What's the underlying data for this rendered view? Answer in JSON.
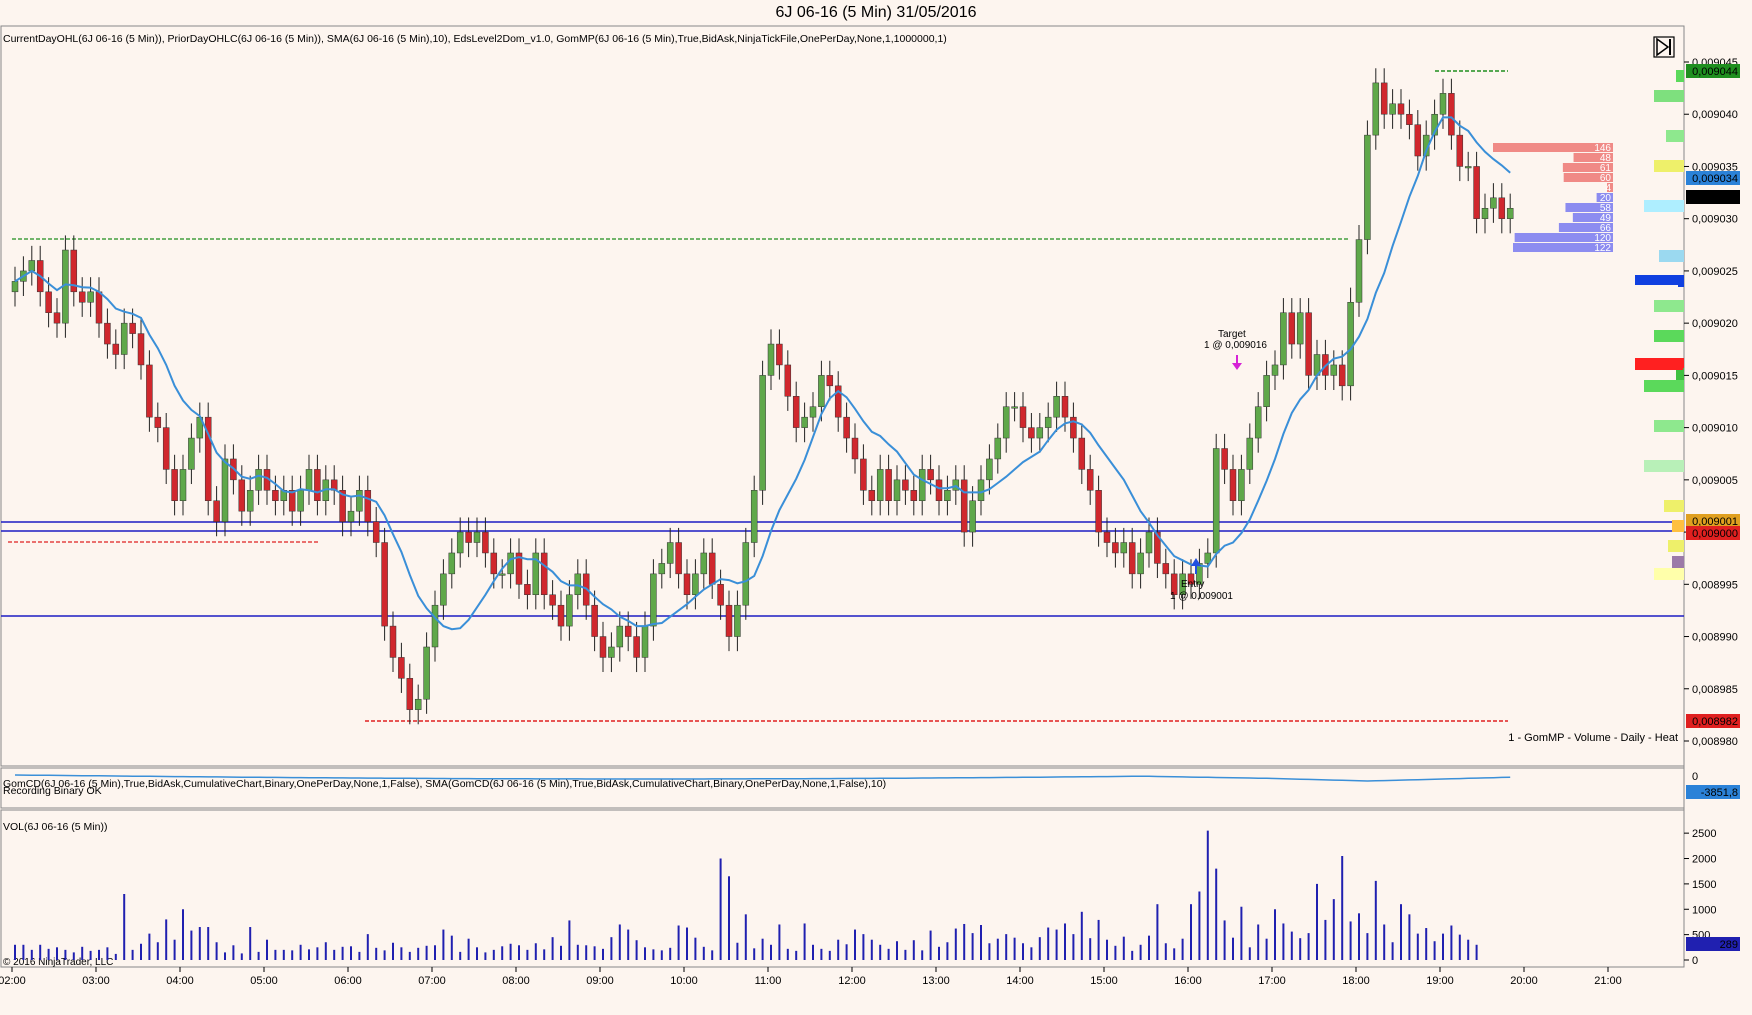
{
  "window": {
    "title": "6J 06-16 (5 Min)  31/05/2016"
  },
  "indicators": {
    "main": "CurrentDayOHL(6J 06-16 (5 Min)), PriorDayOHLC(6J 06-16 (5 Min)), SMA(6J 06-16 (5 Min),10), EdsLevel2Dom_v1.0, GomMP(6J 06-16 (5 Min),True,BidAsk,NinjaTickFile,OnePerDay,None,1,1000000,1)",
    "gomcd": "GomCD(6J 06-16 (5 Min),True,BidAsk,CumulativeChart,Binary,OnePerDay,None,1,False), SMA(GomCD(6J 06-16 (5 Min),True,BidAsk,CumulativeChart,Binary,OnePerDay,None,1,False),10)",
    "recording": "Recording Binary OK",
    "vol": "VOL(6J 06-16 (5 Min))",
    "profile": "1 - GomMP - Volume - Daily - Heat"
  },
  "footer": {
    "copyright": "© 2016 NinjaTrader, LLC"
  },
  "annotations": {
    "target_label": "Target",
    "target_price": "1 @ 0,009016",
    "entry_label": "Entry",
    "entry_price": "1 @ 0,009001"
  },
  "colors": {
    "background": "#fdf5ef",
    "bull": "#5fa84a",
    "bear": "#d0272d",
    "sma": "#3a8fd8",
    "hline": "#1c1cc4",
    "current_high": "#1f8f1f",
    "prior_low": "#e02020",
    "volume": "#2020b0"
  },
  "price_badges": {
    "high": "0,009044",
    "sma": "0,009034",
    "last": "0,009032",
    "level1": "0,009001",
    "level2": "0,009000",
    "low": "0,008982",
    "cd": "-3851,8",
    "vol": "289"
  },
  "dom": {
    "asks": [
      "146",
      "48",
      "61",
      "60",
      "4"
    ],
    "bids": [
      "20",
      "58",
      "49",
      "66",
      "120",
      "122"
    ]
  },
  "chart_data": {
    "type": "candlestick",
    "title": "6J 06-16 (5 Min)  31/05/2016",
    "x_ticks": [
      "02:00",
      "03:00",
      "04:00",
      "05:00",
      "06:00",
      "07:00",
      "08:00",
      "09:00",
      "10:00",
      "11:00",
      "12:00",
      "13:00",
      "14:00",
      "15:00",
      "16:00",
      "17:00",
      "18:00",
      "19:00",
      "20:00",
      "21:00"
    ],
    "y_ticks": [
      "0,008980",
      "0,008985",
      "0,008990",
      "0,008995",
      "0,009000",
      "0,009005",
      "0,009010",
      "0,009015",
      "0,009020",
      "0,009025",
      "0,009030",
      "0,009035",
      "0,009040",
      "0,009045"
    ],
    "ylim": [
      0.008978,
      0.009046
    ],
    "close": [
      9024,
      9025,
      9026,
      9023,
      9021,
      9020,
      9027,
      9023,
      9022,
      9023,
      9020,
      9018,
      9017,
      9020,
      9019,
      9016,
      9011,
      9010,
      9006,
      9003,
      9006,
      9009,
      9011,
      9003,
      9001,
      9007,
      9005,
      9002,
      9004,
      9006,
      9004,
      9003,
      9004,
      9002,
      9004,
      9006,
      9003,
      9005,
      9004,
      9001,
      9002,
      9004,
      9001,
      8999,
      8991,
      8988,
      8986,
      8983,
      8984,
      8989,
      8993,
      8996,
      8998,
      9000,
      8999,
      9000,
      8998,
      8996,
      8996,
      8998,
      8995,
      8994,
      8998,
      8994,
      8993,
      8991,
      8994,
      8996,
      8993,
      8990,
      8988,
      8989,
      8991,
      8990,
      8988,
      8991,
      8996,
      8997,
      8999,
      8996,
      8994,
      8996,
      8998,
      8995,
      8993,
      8990,
      8993,
      8999,
      9004,
      9015,
      9018,
      9016,
      9013,
      9010,
      9011,
      9012,
      9015,
      9014,
      9011,
      9009,
      9007,
      9004,
      9003,
      9006,
      9003,
      9005,
      9004,
      9003,
      9006,
      9005,
      9003,
      9004,
      9005,
      9000,
      9003,
      9005,
      9007,
      9009,
      9012,
      9012,
      9010,
      9009,
      9010,
      9011,
      9013,
      9011,
      9009,
      9006,
      9004,
      9000,
      8999,
      8998,
      8999,
      8996,
      8998,
      9000,
      8997,
      8996,
      8994,
      8996,
      8995,
      8997,
      8998,
      9008,
      9006,
      9003,
      9006,
      9009,
      9012,
      9015,
      9016,
      9021,
      9018,
      9021,
      9015,
      9017,
      9015,
      9016,
      9014,
      9022,
      9028,
      9038,
      9043,
      9040,
      9041,
      9040,
      9039,
      9036,
      9038,
      9040,
      9042,
      9038,
      9035,
      9035,
      9030,
      9031,
      9032,
      9030,
      9031
    ],
    "sma_label": "SMA(6J 06-16 (5 Min),10)",
    "volume_y_ticks": [
      "2500",
      "2000",
      "1500",
      "1000",
      "500",
      "0"
    ],
    "volume": [
      300,
      300,
      200,
      300,
      220,
      250,
      200,
      150,
      260,
      180,
      200,
      250,
      120,
      1300,
      200,
      320,
      520,
      350,
      800,
      400,
      1000,
      580,
      650,
      650,
      350,
      150,
      290,
      130,
      650,
      160,
      400,
      200,
      200,
      190,
      300,
      210,
      250,
      350,
      200,
      260,
      270,
      160,
      510,
      240,
      190,
      340,
      250,
      160,
      240,
      280,
      290,
      600,
      480,
      160,
      420,
      250,
      150,
      200,
      270,
      320,
      290,
      200,
      330,
      210,
      450,
      280,
      780,
      300,
      290,
      270,
      220,
      450,
      700,
      600,
      390,
      250,
      210,
      190,
      240,
      680,
      640,
      440,
      260,
      190,
      2000,
      1650,
      340,
      900,
      230,
      420,
      300,
      700,
      220,
      180,
      720,
      300,
      220,
      180,
      400,
      310,
      600,
      510,
      400,
      300,
      220,
      370,
      200,
      390,
      190,
      580,
      260,
      350,
      620,
      710,
      530,
      690,
      330,
      420,
      510,
      440,
      330,
      250,
      450,
      640,
      600,
      720,
      510,
      950,
      430,
      790,
      400,
      280,
      460,
      180,
      300,
      480,
      1100,
      330,
      230,
      420,
      1100,
      1350,
      2550,
      1800,
      780,
      440,
      1050,
      250,
      700,
      420,
      1000,
      720,
      560,
      430,
      530,
      1500,
      790,
      1200,
      2050,
      760,
      920,
      530,
      1560,
      700,
      350,
      1100,
      900,
      520,
      630,
      370,
      520,
      680,
      500,
      400,
      300
    ],
    "dom_bids": [
      20,
      58,
      49,
      66,
      120,
      122
    ],
    "dom_asks": [
      146,
      48,
      61,
      60,
      4
    ]
  }
}
